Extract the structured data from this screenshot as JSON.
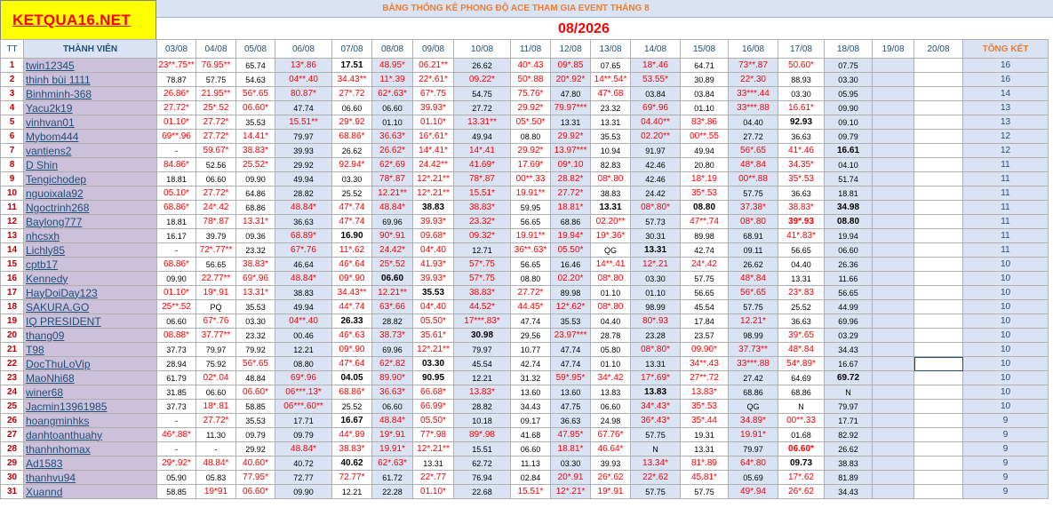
{
  "header": {
    "logo_text": "KETQUA16.NET",
    "title": "BẢNG THỐNG KÊ PHONG ĐỘ ACE THAM GIA EVENT THÁNG 8",
    "month": "08/2026"
  },
  "columns": {
    "tt": "TT",
    "member": "THÀNH VIÊN",
    "dates": [
      "03/08",
      "04/08",
      "05/08",
      "06/08",
      "07/08",
      "08/08",
      "09/08",
      "10/08",
      "11/08",
      "12/08",
      "13/08",
      "14/08",
      "15/08",
      "16/08",
      "17/08",
      "18/08",
      "19/08",
      "20/08"
    ],
    "total": "TỔNG KẾT"
  },
  "colors": {
    "logo_bg": "#ffff00",
    "logo_text": "#ff0000",
    "title_text": "#ed7d31",
    "month_text": "#ff0000",
    "name_bg": "#ccc0da",
    "shaded_col": "#dae3f3",
    "red_value": "#ff0000",
    "row_number": "#c00000"
  },
  "rows": [
    {
      "tt": "1",
      "name": "twin12345",
      "vals": [
        "r23**.75**",
        "r76.95**",
        "k65.74",
        "r13*.86",
        "K17.51",
        "r48.95*",
        "r06.21**",
        "k26.62",
        "r40*.43",
        "r09*.85",
        "k07.65",
        "r18*.46",
        "k64.71",
        "r73**.87",
        "r50.60*",
        "k07.75",
        "",
        ""
      ],
      "total": "16"
    },
    {
      "tt": "2",
      "name": "thinh bùi 1111",
      "vals": [
        "k78.87",
        "k57.75",
        "k54.63",
        "r04**.40",
        "r34.43**",
        "r11*.39",
        "r22*.61*",
        "r09.22*",
        "r50*.88",
        "r20*.92*",
        "r14**.54*",
        "r53.55*",
        "k30.89",
        "r22*.30",
        "k88.93",
        "k03.30",
        "",
        ""
      ],
      "total": "16"
    },
    {
      "tt": "3",
      "name": "Binhminh-368",
      "vals": [
        "r26.86*",
        "r21.95**",
        "r56*.65",
        "r80.87*",
        "r27*.72",
        "r62*.63*",
        "r67*.75",
        "k54.75",
        "r75.76*",
        "k47.80",
        "r47*.68",
        "k03.84",
        "k03.84",
        "r33***.44",
        "k03.30",
        "k05.95",
        "",
        ""
      ],
      "total": "14"
    },
    {
      "tt": "4",
      "name": "Yacu2k19",
      "vals": [
        "r27.72*",
        "r25*.52",
        "r06.60*",
        "k47.74",
        "k06.60",
        "k06.60",
        "r39.93*",
        "k27.72",
        "r29.92*",
        "r79.97***",
        "k23.32",
        "r69*.96",
        "k01.10",
        "r33***.88",
        "r16.61*",
        "k09.90",
        "",
        ""
      ],
      "total": "13"
    },
    {
      "tt": "5",
      "name": "vinhvan01",
      "vals": [
        "r01.10*",
        "r27.72*",
        "k35.53",
        "r15.51**",
        "r29*.92",
        "k01.10",
        "r01.10*",
        "r13.31**",
        "r05*.50*",
        "k13.31",
        "k13.31",
        "r04.40**",
        "r83*.86",
        "k04.40",
        "K92.93",
        "k09.10",
        "",
        ""
      ],
      "total": "13"
    },
    {
      "tt": "6",
      "name": "Mybom444",
      "vals": [
        "r69**.96",
        "r27.72*",
        "r14.41*",
        "k79.97",
        "r68.86*",
        "r36.63*",
        "r16*.61*",
        "k49.94",
        "k08.80",
        "r29.92*",
        "k35.53",
        "r02.20**",
        "r00**.55",
        "k27.72",
        "k36.63",
        "k09.79",
        "",
        ""
      ],
      "total": "12"
    },
    {
      "tt": "7",
      "name": "vantiens2",
      "vals": [
        "k-",
        "r59.67*",
        "r38.83*",
        "k39.93",
        "k26.62",
        "r26.62*",
        "r14*.41*",
        "r14*.41",
        "r29.92*",
        "r13.97***",
        "k10.94",
        "k91.97",
        "k49.94",
        "r56*.65",
        "r41*.46",
        "K16.61",
        "",
        ""
      ],
      "total": "12"
    },
    {
      "tt": "8",
      "name": "D Shin",
      "vals": [
        "r84.86*",
        "k52.56",
        "r25.52*",
        "k29.92",
        "r92.94*",
        "r62*.69",
        "r24.42**",
        "r41.69*",
        "r17.69*",
        "r09*.10",
        "k82.83",
        "k42.46",
        "k20.80",
        "r48*.84",
        "r34.35*",
        "k04.10",
        "",
        ""
      ],
      "total": "11"
    },
    {
      "tt": "9",
      "name": "Tengichodep",
      "vals": [
        "k18.81",
        "k06.60",
        "k09.90",
        "k49.94",
        "k03.30",
        "r78*.87",
        "r12*.21**",
        "r78*.87",
        "r00**.33",
        "r28.82*",
        "r08*.80",
        "k42.46",
        "r18*.19",
        "r00**.88",
        "r35*.53",
        "k51.74",
        "",
        ""
      ],
      "total": "11"
    },
    {
      "tt": "10",
      "name": "nguoixala92",
      "vals": [
        "r05.10*",
        "r27.72*",
        "k64.86",
        "k28.82",
        "k25.52",
        "r12.21**",
        "r12*.21**",
        "r15.51*",
        "r19.91**",
        "r27.72*",
        "k38.83",
        "k24.42",
        "r35*.53",
        "k57.75",
        "k36.63",
        "k18.81",
        "",
        ""
      ],
      "total": "11"
    },
    {
      "tt": "11",
      "name": "Ngoctrinh268",
      "vals": [
        "r68.86*",
        "r24*.42",
        "k68.86",
        "r48.84*",
        "r47*.74",
        "r48.84*",
        "K38.83",
        "r38.83*",
        "k59.95",
        "r18.81*",
        "K13.31",
        "r08*.80*",
        "K08.80",
        "r37.38*",
        "r38.83*",
        "K34.98",
        "",
        ""
      ],
      "total": "11"
    },
    {
      "tt": "12",
      "name": "Baylong777",
      "vals": [
        "k18.81",
        "r78*.87",
        "r13.31*",
        "k36.63",
        "r47*.74",
        "k69.96",
        "r39.93*",
        "r23.32*",
        "k56.65",
        "k68.86",
        "r02.20**",
        "k57.73",
        "r47**.74",
        "r08*.80",
        "R39*.93",
        "K08.80",
        "",
        ""
      ],
      "total": "11"
    },
    {
      "tt": "13",
      "name": "nhcsxh",
      "vals": [
        "k16.17",
        "k39.79",
        "k09.36",
        "r68.89*",
        "K16.90",
        "r90*.91",
        "r09.68*",
        "r09.32*",
        "r19.91**",
        "r19.94*",
        "r19*.36*",
        "k30.31",
        "k89.98",
        "k68.91",
        "r41*.83*",
        "k19.94",
        "",
        ""
      ],
      "total": "11"
    },
    {
      "tt": "14",
      "name": "Lichly85",
      "vals": [
        "k-",
        "r72*.77**",
        "k23.32",
        "r67*.76",
        "r11*.62",
        "r24.42*",
        "r04*.40",
        "k12.71",
        "r36**.63*",
        "r05.50*",
        "kQG",
        "K13.31",
        "k42.74",
        "k09.11",
        "k56.65",
        "k06.60",
        "",
        ""
      ],
      "total": "11"
    },
    {
      "tt": "15",
      "name": "cptb17",
      "vals": [
        "r68.86*",
        "k56.65",
        "r38.83*",
        "k46.64",
        "r46*.64",
        "r25*.52",
        "r41.93*",
        "r57*.75",
        "k56.65",
        "k16.46",
        "r14**.41",
        "r12*.21",
        "r24*.42",
        "k26.62",
        "k04.40",
        "k26.36",
        "",
        ""
      ],
      "total": "10"
    },
    {
      "tt": "16",
      "name": "Kennedy",
      "vals": [
        "k09.90",
        "r22.77**",
        "r69*.96",
        "r48.84*",
        "r09*.90",
        "K06.60",
        "r39.93*",
        "r57*.75",
        "k08.80",
        "r02.20*",
        "r08*.80",
        "k03.30",
        "k57.75",
        "r48*.84",
        "k13.31",
        "k11.66",
        "",
        ""
      ],
      "total": "10"
    },
    {
      "tt": "17",
      "name": "HayDoiDay123",
      "vals": [
        "r01.10*",
        "r19*.91",
        "r13.31*",
        "k38.83",
        "r34.43**",
        "r12.21**",
        "K35.53",
        "r38.83*",
        "r27.72*",
        "k89.98",
        "k01.10",
        "k01.10",
        "k56.65",
        "r56*.65",
        "r23*.83",
        "k56.65",
        "",
        ""
      ],
      "total": "10"
    },
    {
      "tt": "18",
      "name": "SAKURA.GO",
      "vals": [
        "r25**.52",
        "kPQ",
        "k35.53",
        "k49.94",
        "r44*.74",
        "r63*.66",
        "r04*.40",
        "r44.52*",
        "r44.45*",
        "r12*.62*",
        "r08*.80",
        "k98.99",
        "k45.54",
        "k57.75",
        "k25.52",
        "k44.99",
        "",
        ""
      ],
      "total": "10"
    },
    {
      "tt": "19",
      "name": "IQ PRESIDENT",
      "vals": [
        "k06.60",
        "r67*.76",
        "k03.30",
        "r04**.40",
        "K26.33",
        "k28.82",
        "r05.50*",
        "r17***.83*",
        "k47.74",
        "k35.53",
        "k04.40",
        "r80*.93",
        "k17.84",
        "r12.21*",
        "k36.63",
        "k69.96",
        "",
        ""
      ],
      "total": "10"
    },
    {
      "tt": "20",
      "name": "thang09",
      "vals": [
        "r08.88*",
        "r37.77**",
        "k23.32",
        "k00.46",
        "r46*.63",
        "r38.73*",
        "r35.61*",
        "K30.98",
        "k29.56",
        "r23.97***",
        "k28.78",
        "k23.28",
        "k23.57",
        "k98.99",
        "r39*.65",
        "k03.29",
        "",
        ""
      ],
      "total": "10"
    },
    {
      "tt": "21",
      "name": "T98",
      "vals": [
        "k37.73",
        "k79.97",
        "k79.92",
        "k12.21",
        "r09*.90",
        "k69.96",
        "r12*.21**",
        "k79.97",
        "k10.77",
        "k47.74",
        "k05.80",
        "r08*.80*",
        "r09.90*",
        "r37.73**",
        "r48*.84",
        "k34.43",
        "",
        ""
      ],
      "total": "10"
    },
    {
      "tt": "22",
      "name": "DocThuLoVip",
      "vals": [
        "k28.94",
        "k75.92",
        "r56*.65",
        "k08.80",
        "r47*.64",
        "r62*.82",
        "K03.30",
        "k45.54",
        "k42.74",
        "k47.74",
        "k01.10",
        "k13.31",
        "r34**.43",
        "r33***.88",
        "r54*.89*",
        "k16.67",
        "",
        ""
      ],
      "total": "10"
    },
    {
      "tt": "23",
      "name": "MaoNhi68",
      "vals": [
        "k61.79",
        "r02*.04",
        "k48.84",
        "r69*.96",
        "K04.05",
        "r89.90*",
        "K90.95",
        "k12.21",
        "k31.32",
        "r59*.95*",
        "r34*.42",
        "r17*.69*",
        "r27**.72",
        "k27.42",
        "k64.69",
        "K69.72",
        "",
        ""
      ],
      "total": "10"
    },
    {
      "tt": "24",
      "name": "winer68",
      "vals": [
        "k31.85",
        "k06.60",
        "r06.60*",
        "r06***.13*",
        "r68.86*",
        "r36.63*",
        "r66.68*",
        "r13.83*",
        "k13.60",
        "k13.60",
        "k13.83",
        "K13.83",
        "r13.83*",
        "k68.86",
        "k68.86",
        "kN",
        "",
        ""
      ],
      "total": "10"
    },
    {
      "tt": "25",
      "name": "Jacmin13961985",
      "vals": [
        "k37.73",
        "r18*.81",
        "k58.85",
        "r06***.60**",
        "k25.52",
        "k06.60",
        "r66.99*",
        "k28.82",
        "k34.43",
        "k47.75",
        "k06.60",
        "r34*.43*",
        "r35*.53",
        "kQG",
        "kN",
        "k79.97",
        "",
        ""
      ],
      "total": "10"
    },
    {
      "tt": "26",
      "name": "hoangminhks",
      "vals": [
        "k-",
        "r27.72*",
        "k35.53",
        "k17.71",
        "K16.67",
        "r48.84*",
        "r05.50*",
        "k10.18",
        "k09.17",
        "k36.63",
        "k24.98",
        "r36*.43*",
        "r35*.44",
        "r34.89*",
        "r00**.33",
        "k17.71",
        "",
        ""
      ],
      "total": "9"
    },
    {
      "tt": "27",
      "name": "danhtoanthuahy",
      "vals": [
        "r46*.88*",
        "k11.30",
        "k09.79",
        "k09.79",
        "r44*.99",
        "r19*.91",
        "r77*.98",
        "r89*.98",
        "k41.68",
        "r47.95*",
        "r67.76*",
        "k57.75",
        "k19.31",
        "r19.91*",
        "k01.68",
        "k82.92",
        "",
        ""
      ],
      "total": "9"
    },
    {
      "tt": "28",
      "name": "thanhnhomax",
      "vals": [
        "k-",
        "k-",
        "k29.92",
        "r48.84*",
        "r38.83*",
        "r19.91*",
        "r12*.21**",
        "k15.51",
        "k06.60",
        "r18.81*",
        "r46.64*",
        "kN",
        "k13.31",
        "k79.97",
        "R06.60*",
        "k26.62",
        "",
        ""
      ],
      "total": "9"
    },
    {
      "tt": "29",
      "name": "Ad1583",
      "vals": [
        "r29*.92*",
        "r48.84*",
        "r40.60*",
        "k40.72",
        "K40.62",
        "r62*.63*",
        "k13.31",
        "k62.72",
        "k11.13",
        "k03.30",
        "k39.93",
        "r13.34*",
        "r81*.89",
        "r64*.80",
        "K09.73",
        "k38.83",
        "",
        ""
      ],
      "total": "9"
    },
    {
      "tt": "30",
      "name": "thanhvu94",
      "vals": [
        "k05.90",
        "k05.83",
        "r77.95*",
        "k72.77",
        "r72.77*",
        "k61.72",
        "r22*.77",
        "k76.94",
        "k02.84",
        "r20*.91",
        "r26*.62",
        "r22*.62",
        "r45.81*",
        "k05.69",
        "r17*.62",
        "k81.89",
        "",
        ""
      ],
      "total": "9"
    },
    {
      "tt": "31",
      "name": "Xuannd",
      "vals": [
        "k58.85",
        "r19*91",
        "r06.60*",
        "k09.90",
        "k12.21",
        "k22.28",
        "r01.10*",
        "k22.68",
        "r15.51*",
        "r12*.21*",
        "r19*.91",
        "k57.75",
        "k57.75",
        "r49*.94",
        "r26*.62",
        "k34.43",
        "",
        ""
      ],
      "total": "9"
    }
  ]
}
